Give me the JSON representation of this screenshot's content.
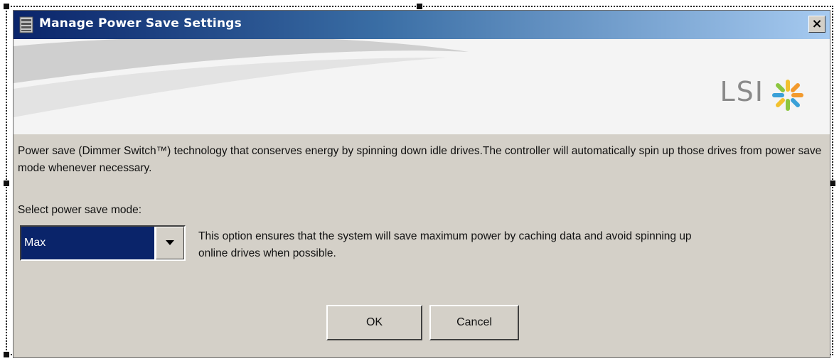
{
  "window": {
    "title": "Manage Power Save Settings",
    "close_label": "×"
  },
  "banner": {
    "logo_text": "LSI",
    "logo_colors": [
      "#f29a2e",
      "#8cc63f",
      "#3aa0d8",
      "#f2c12e"
    ]
  },
  "description": "Power save (Dimmer Switch™) technology that conserves energy by spinning down idle drives.The controller will automatically spin up those drives from power save mode whenever necessary.",
  "mode_select": {
    "label": "Select power save mode:",
    "selected": "Max",
    "option_description": "This option ensures that the system will save maximum power by caching data and avoid spinning up online drives when possible."
  },
  "buttons": {
    "ok": "OK",
    "cancel": "Cancel"
  },
  "colors": {
    "title_gradient_start": "#0a246a",
    "selection_highlight": "#0a246a",
    "dialog_face": "#d4d0c8"
  }
}
